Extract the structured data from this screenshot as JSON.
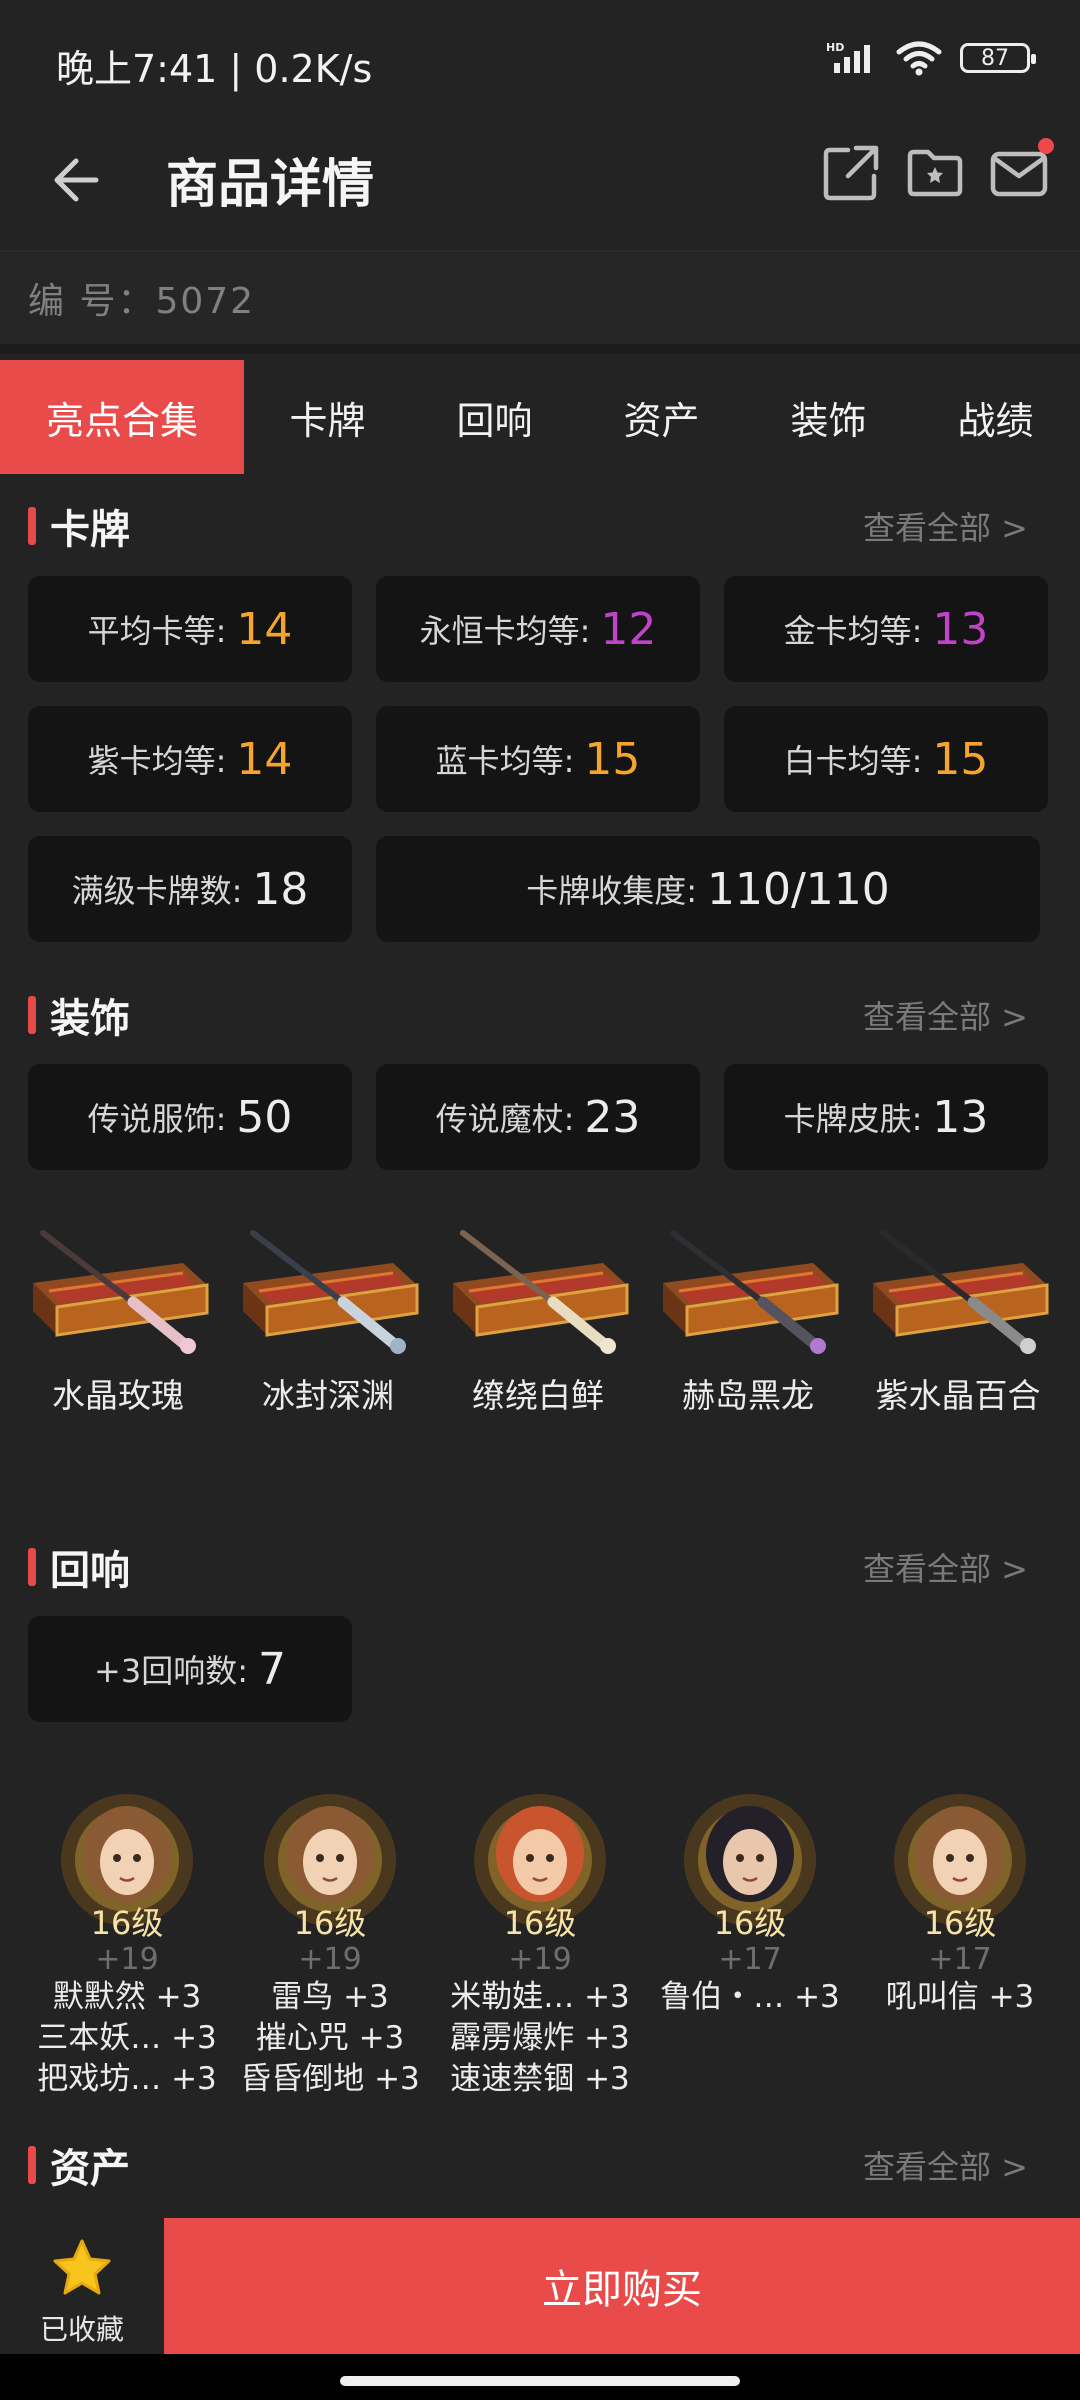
{
  "status": {
    "time_speed": "晚上7:41 | 0.2K/s",
    "battery": "87"
  },
  "header": {
    "title": "商品详情"
  },
  "serial": "编  号：5072",
  "tabs": [
    "亮点合集",
    "卡牌",
    "回响",
    "资产",
    "装饰",
    "战绩"
  ],
  "cards": {
    "title": "卡牌",
    "view_all": "查看全部 >",
    "stats": [
      {
        "label": "平均卡等:",
        "value": "14",
        "color": "#f5a42c"
      },
      {
        "label": "永恒卡均等:",
        "value": "12",
        "color": "#c043c9"
      },
      {
        "label": "金卡均等:",
        "value": "13",
        "color": "#c043c9"
      },
      {
        "label": "紫卡均等:",
        "value": "14",
        "color": "#f5a42c"
      },
      {
        "label": "蓝卡均等:",
        "value": "15",
        "color": "#f5a42c"
      },
      {
        "label": "白卡均等:",
        "value": "15",
        "color": "#f5a42c"
      },
      {
        "label": "满级卡牌数:",
        "value": "18",
        "color": "#ececec"
      },
      {
        "label": "卡牌收集度:",
        "value": "110/110",
        "color": "#ececec"
      }
    ]
  },
  "decor": {
    "title": "装饰",
    "view_all": "查看全部 >",
    "stats": [
      {
        "label": "传说服饰:",
        "value": "50"
      },
      {
        "label": "传说魔杖:",
        "value": "23"
      },
      {
        "label": "卡牌皮肤:",
        "value": "13"
      }
    ],
    "wands": [
      {
        "name": "水晶玫瑰",
        "shaft": "#4a3a3a",
        "handle": "#e6bfc8",
        "tip": "#f0c6d8"
      },
      {
        "name": "冰封深渊",
        "shaft": "#3a3f4a",
        "handle": "#c9d3de",
        "tip": "#9fb2c8"
      },
      {
        "name": "缭绕白鲜",
        "shaft": "#7a6450",
        "handle": "#e8dcc3",
        "tip": "#efe6d0"
      },
      {
        "name": "赫岛黑龙",
        "shaft": "#2e2e33",
        "handle": "#55535e",
        "tip": "#b07ad0"
      },
      {
        "name": "紫水晶百合",
        "shaft": "#2a2a2a",
        "handle": "#8a8a8a",
        "tip": "#cfcfcf"
      }
    ]
  },
  "echo": {
    "title": "回响",
    "view_all": "查看全部 >",
    "stat": {
      "label": "+3回响数:",
      "value": "7"
    },
    "characters": [
      {
        "level": "16级",
        "plus": "+19",
        "hair": "#8a5a34",
        "skin": "#f1d2b5",
        "skills": [
          "默默然 +3",
          "三本妖…  +3",
          "把戏坊…  +3"
        ]
      },
      {
        "level": "16级",
        "plus": "+19",
        "hair": "#8a5a34",
        "skin": "#f1d2b5",
        "skills": [
          "雷鸟 +3",
          "摧心咒 +3",
          "昏昏倒地 +3"
        ]
      },
      {
        "level": "16级",
        "plus": "+19",
        "hair": "#c9552e",
        "skin": "#f3c9a8",
        "skills": [
          "米勒娃…  +3",
          "霹雳爆炸 +3",
          "速速禁锢 +3"
        ]
      },
      {
        "level": "16级",
        "plus": "+17",
        "hair": "#232029",
        "skin": "#e9c7ad",
        "skills": [
          "鲁伯・…  +3"
        ]
      },
      {
        "level": "16级",
        "plus": "+17",
        "hair": "#8a5a34",
        "skin": "#f1d2b5",
        "skills": [
          "吼叫信 +3"
        ]
      }
    ]
  },
  "assets": {
    "title": "资产",
    "view_all": "查看全部 >"
  },
  "bottom": {
    "fav_label": "已收藏",
    "buy_label": "立即购买"
  }
}
